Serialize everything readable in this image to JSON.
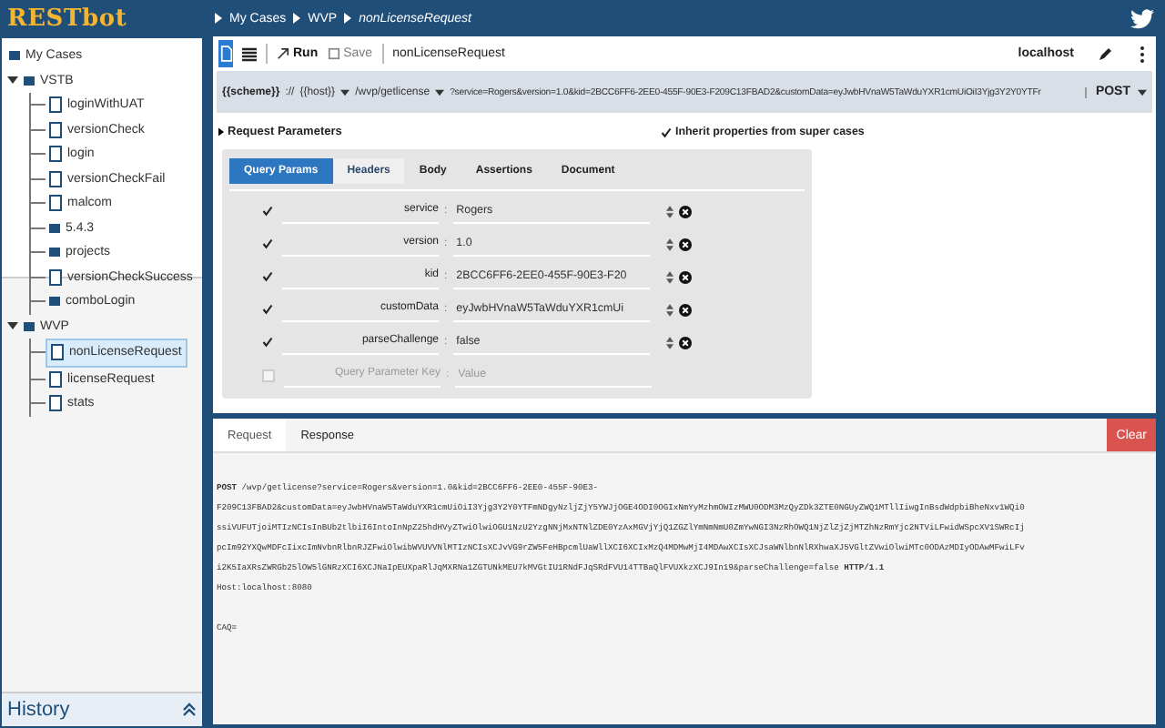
{
  "app": {
    "logo": "RESTbot"
  },
  "breadcrumb": [
    "My Cases",
    "WVP",
    "nonLicenseRequest"
  ],
  "sidebar": {
    "tree": [
      {
        "label": "My Cases",
        "kind": "folder",
        "selected": false,
        "children": [
          {
            "label": "VSTB",
            "kind": "folder",
            "selected": false,
            "expanded": true,
            "children": [
              {
                "label": "loginWithUAT",
                "kind": "file",
                "selected": false
              },
              {
                "label": "versionCheck",
                "kind": "file",
                "selected": false
              },
              {
                "label": "login",
                "kind": "file",
                "selected": false
              },
              {
                "label": "versionCheckFail",
                "kind": "file",
                "selected": false
              },
              {
                "label": "malcom",
                "kind": "file",
                "selected": false
              },
              {
                "label": "5.4.3",
                "kind": "folder",
                "selected": false
              },
              {
                "label": "projects",
                "kind": "folder",
                "selected": false
              },
              {
                "label": "versionCheckSuccess",
                "kind": "file",
                "selected": false
              },
              {
                "label": "comboLogin",
                "kind": "folder",
                "selected": false
              }
            ]
          },
          {
            "label": "WVP",
            "kind": "folder",
            "selected": false,
            "expanded": true,
            "children": [
              {
                "label": "nonLicenseRequest",
                "kind": "file",
                "selected": true
              },
              {
                "label": "licenseRequest",
                "kind": "file",
                "selected": false
              },
              {
                "label": "stats",
                "kind": "file",
                "selected": false
              }
            ]
          }
        ]
      }
    ],
    "history_label": "History"
  },
  "toolbar": {
    "run": "Run",
    "save": "Save",
    "case_name": "nonLicenseRequest",
    "environment": "localhost"
  },
  "url_bar": {
    "scheme": "{{scheme}}",
    "separator": "://",
    "host": "{{host}}",
    "path": "/wvp/getlicense",
    "query": "?service=Rogers&version=1.0&kid=2BCC6FF6-2EE0-455F-90E3-F209C13FBAD2&customData=eyJwbHVnaW5TaWduYXR1cmUiOiI3Yjg3Y2Y0YTFr",
    "method": "POST"
  },
  "request_parameters": {
    "title": "Request Parameters",
    "inherit": {
      "label": "Inherit properties from super cases",
      "checked": true
    },
    "tabs": [
      {
        "label": "Query Params",
        "selected": true
      },
      {
        "label": "Headers",
        "selected": false
      },
      {
        "label": "Body",
        "selected": false
      },
      {
        "label": "Assertions",
        "selected": false
      },
      {
        "label": "Document",
        "selected": false
      }
    ],
    "params": [
      {
        "key": "service",
        "separator": ":",
        "value": "Rogers",
        "checked": true
      },
      {
        "key": "version",
        "separator": ":",
        "value": "1.0",
        "checked": true
      },
      {
        "key": "kid",
        "separator": ":",
        "value": "2BCC6FF6-2EE0-455F-90E3-F20",
        "checked": true
      },
      {
        "key": "customData",
        "separator": ":",
        "value": "eyJwbHVnaW5TaWduYXR1cmUi",
        "checked": true
      },
      {
        "key": "parseChallenge",
        "separator": ":",
        "value": "false",
        "checked": true
      }
    ],
    "new_param": {
      "key_placeholder": "Query Parameter Key",
      "separator": ":",
      "value_placeholder": "Value",
      "checked": false
    }
  },
  "output": {
    "tabs": [
      {
        "label": "Request",
        "selected": true
      },
      {
        "label": "Response",
        "selected": false
      }
    ],
    "clear": "Clear",
    "lines": [
      "**POST** /wvp/getlicense?service=Rogers&version=1.0&kid=2BCC6FF6-2EE0-455F-90E3-",
      "F209C13FBAD2&customData=eyJwbHVnaW5TaWduYXR1cmUiOiI3Yjg3Y2Y0YTFmNDgyNzljZjY5YWJjOGE4ODI0OGIxNmYyMzhmOWIzMWU0ODM3MzQyZDk3ZTE0NGUyZWQ1MTllIiwgInBsdWdpbiBheNxv1WQi0",
      "ssiVUFUTjoiMTIzNCIsInBUb2tlbiI6IntoInNpZ25hdHVyZTwiOlwiOGU1NzU2YzgNNjMxNTNlZDE0YzAxMGVjYjQ1ZGZlYmNmNmU0ZmYwNGI3NzRhOWQ1NjZlZjZjMTZhNzRmYjc2NTViLFwidWSpcXV1SWRcIj",
      "pcIm92YXQwMDFcIixcImNvbnRlbnRJZFwiOlwibWVUVVNlMTIzNCIsXCJvVG9rZW5FeHBpcmlUaWllXCI6XCIxMzQ4MDMwMjI4MDAwXCIsXCJsaWNlbnNlRXhwaXJ5VGltZVwiOlwiMTc0ODAzMDIyODAwMFwiLFv",
      "i2K5IaXRsZWRGb25lOW5lGNRzXCI6XCJNaIpEUXpaRlJqMXRNa1ZGTUNkMEU7kMVGtIU1RNdFJqSRdFVU14TTBaQlFVUXkzXCJ9In19&parseChallenge=false **HTTP/1.1**",
      "Host:localhost:8080"
    ],
    "body_lines": [
      "CAQ="
    ]
  }
}
